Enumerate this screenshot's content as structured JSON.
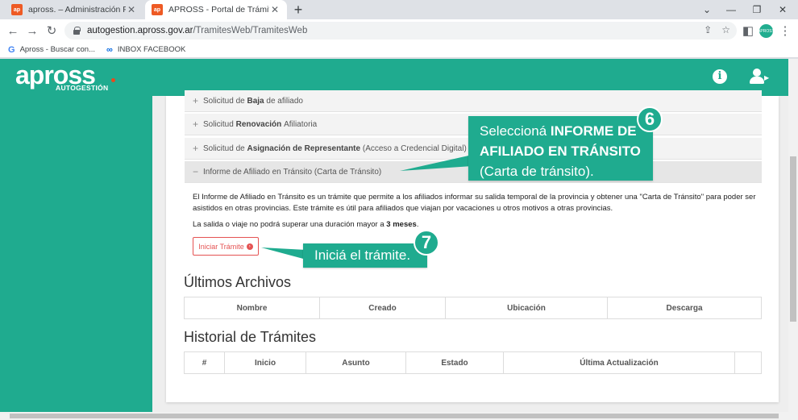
{
  "browser": {
    "tabs": [
      {
        "favicon": "ap",
        "title": "apross. – Administración Provincial"
      },
      {
        "favicon": "ap",
        "title": "APROSS - Portal de Trámites en Lí"
      }
    ],
    "new_tab": "+",
    "url_host": "autogestion.apross.gov.ar",
    "url_path": "/TramitesWeb/TramitesWeb",
    "profile_label": "APROSS",
    "bookmarks": [
      {
        "icon": "google-icon",
        "label": "Apross - Buscar con..."
      },
      {
        "icon": "meta-icon",
        "label": "INBOX FACEBOOK"
      }
    ]
  },
  "app": {
    "logo": "apross",
    "logo_sub": "AUTOGESTIÓN",
    "info_icon": "i"
  },
  "accordion": [
    {
      "sign": "+",
      "pre": "Solicitud de ",
      "bold": "Baja",
      "post": " de afiliado"
    },
    {
      "sign": "+",
      "pre": "Solicitud ",
      "bold": "Renovación",
      "post": " Afiliatoria"
    },
    {
      "sign": "+",
      "pre": "Solicitud de ",
      "bold": "Asignación de Representante",
      "post": " (Acceso a Credencial Digital)"
    },
    {
      "sign": "−",
      "pre": "Informe de Afiliado en Tránsito (Carta de Tránsito)",
      "bold": "",
      "post": ""
    }
  ],
  "description": {
    "line1": "El Informe de Afiliado en Tránsito es un trámite que permite a los afiliados informar su salida temporal de la provincia y obtener una \"Carta de Tránsito\" para poder ser asistidos en otras provincias. Este trámite es útil para afiliados que viajan por vacaciones u otros motivos a otras provincias.",
    "line2_pre": "La salida o viaje no podrá superar una duración mayor a ",
    "line2_bold": "3 meses",
    "line2_post": "."
  },
  "start_button": "Iniciar Trámite",
  "archivos": {
    "title": "Últimos Archivos",
    "headers": [
      "Nombre",
      "Creado",
      "Ubicación",
      "Descarga"
    ]
  },
  "historial": {
    "title": "Historial de Trámites",
    "headers": [
      "#",
      "Inicio",
      "Asunto",
      "Estado",
      "Última Actualización",
      ""
    ]
  },
  "callouts": {
    "c6": {
      "number": "6",
      "pre": "Seleccioná ",
      "bold": "INFORME DE AFILIADO EN TRÁNSITO",
      "post": "(Carta de tránsito)."
    },
    "c7": {
      "number": "7",
      "text": "Iniciá el trámite."
    }
  },
  "colors": {
    "brand": "#1fab8f",
    "danger": "#e55353"
  }
}
